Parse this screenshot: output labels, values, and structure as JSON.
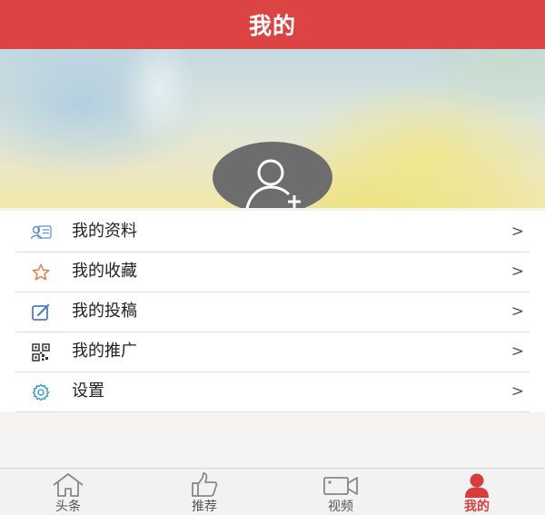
{
  "header": {
    "title": "我的"
  },
  "profile": {
    "avatar_icon": "add-user-icon"
  },
  "menu": {
    "items": [
      {
        "label": "我的资料",
        "icon": "profile-card-icon",
        "arrow": ">"
      },
      {
        "label": "我的收藏",
        "icon": "star-icon",
        "arrow": ">"
      },
      {
        "label": "我的投稿",
        "icon": "edit-icon",
        "arrow": ">"
      },
      {
        "label": "我的推广",
        "icon": "qr-code-icon",
        "arrow": ">"
      },
      {
        "label": "设置",
        "icon": "gear-icon",
        "arrow": ">"
      }
    ]
  },
  "tabbar": {
    "tabs": [
      {
        "label": "头条",
        "icon": "home-icon",
        "active": false
      },
      {
        "label": "推荐",
        "icon": "thumbs-up-icon",
        "active": false
      },
      {
        "label": "视频",
        "icon": "video-camera-icon",
        "active": false
      },
      {
        "label": "我的",
        "icon": "user-icon",
        "active": true
      }
    ]
  },
  "colors": {
    "accent": "#dc4444",
    "active_tab": "#d83c3c"
  }
}
